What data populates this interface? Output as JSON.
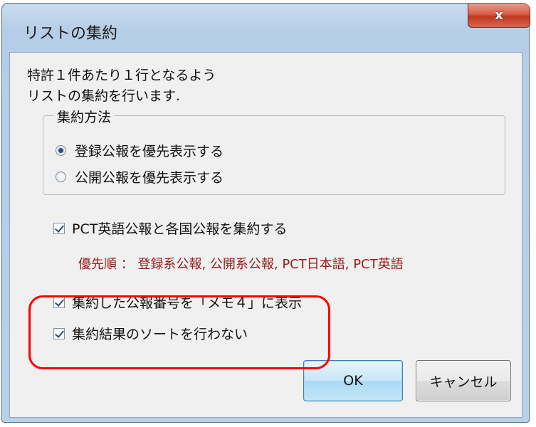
{
  "window": {
    "title": "リストの集約",
    "close_label": "x"
  },
  "description": {
    "line1": "特許１件あたり１行となるよう",
    "line2": "リストの集約を行います."
  },
  "method_group": {
    "legend": "集約方法",
    "options": [
      {
        "label": "登録公報を優先表示する",
        "selected": true
      },
      {
        "label": "公開公報を優先表示する",
        "selected": false
      }
    ]
  },
  "checkboxes": {
    "pct": {
      "label": "PCT英語公報と各国公報を集約する",
      "checked": true
    },
    "memo": {
      "label": "集約した公報番号を「メモ４」に表示",
      "checked": true
    },
    "nosort": {
      "label": "集約結果のソートを行わない",
      "checked": true
    }
  },
  "priority_text": "優先順 ： 登録系公報, 公開系公報, PCT日本語, PCT英語",
  "buttons": {
    "ok": "OK",
    "cancel": "キャンセル"
  },
  "colors": {
    "highlight": "#ff0000",
    "priority_text": "#9b1a1a"
  }
}
